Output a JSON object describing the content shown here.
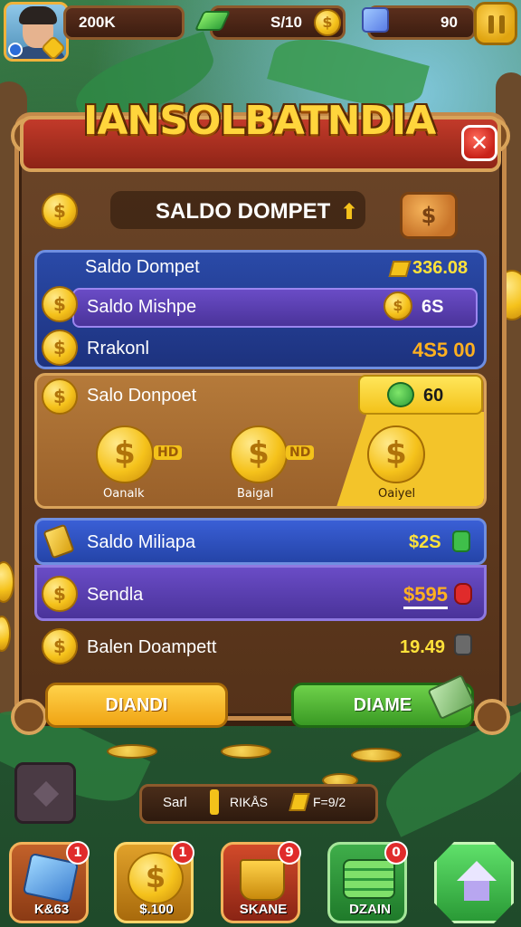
{
  "top_bar": {
    "coins": "200K",
    "gems": "S/10",
    "gifts": "90"
  },
  "panel": {
    "title": "IANSOLBATNDIA",
    "close_icon": "✕",
    "header_label": "SALDO DOMPET",
    "wallet_button_icon": "$"
  },
  "blue_section": {
    "row1_label": "Saldo Dompet",
    "row1_value": "336.08",
    "row2_label": "Saldo Mishpe",
    "row2_value": "6S",
    "row3_label": "Rrakonl",
    "row3_value": "4S5 00"
  },
  "orange_section": {
    "label": "Salo Donpoet",
    "bonus_value": "60",
    "coin_items": [
      {
        "tag": "HD",
        "caption": "Oanalk"
      },
      {
        "tag": "ND",
        "caption": "Baigal"
      },
      {
        "tag": "",
        "caption": "Oaiyel"
      }
    ]
  },
  "rows": {
    "row4_label": "Saldo Miliapa",
    "row4_value": "$2S",
    "row5_label": "Sendla",
    "row5_value": "$595",
    "row6_label": "Balen Doampett",
    "row6_value": "19.49"
  },
  "buttons": {
    "left": "DIANDI",
    "right": "DIAME"
  },
  "mid_bar": {
    "label_a": "Sarl",
    "label_b": "RIKÅS",
    "label_c": "F=9/2"
  },
  "dock": [
    {
      "label": "K&63",
      "badge": "1",
      "icon": "gem-icon",
      "color": "#3d7fd0"
    },
    {
      "label": "$.100",
      "badge": "1",
      "icon": "coin-icon",
      "color": "#d99a1c"
    },
    {
      "label": "SKANE",
      "badge": "9",
      "icon": "coin-bucket-icon",
      "color": "#c2412a"
    },
    {
      "label": "DZAIN",
      "badge": "0",
      "icon": "cash-stack-icon",
      "color": "#2f9a3c"
    },
    {
      "label": "",
      "badge": "",
      "icon": "home-icon",
      "color": "#3fbf4a"
    }
  ]
}
